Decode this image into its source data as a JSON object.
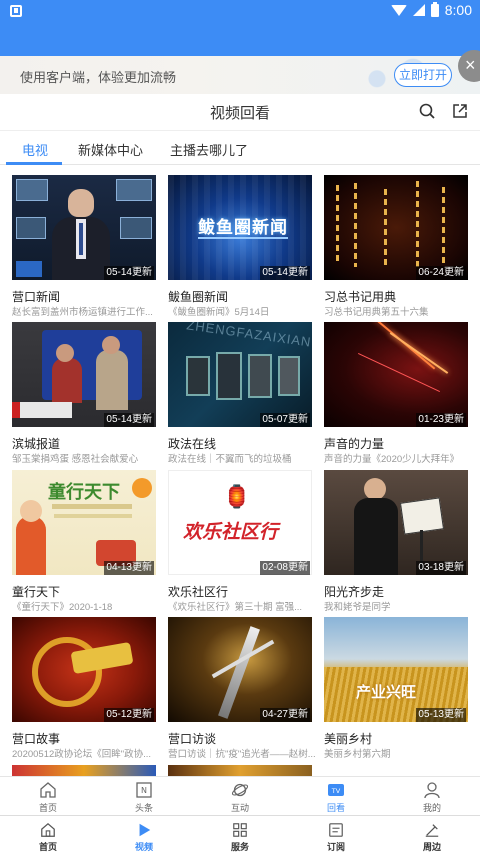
{
  "statusbar": {
    "time": "8:00"
  },
  "banner": {
    "text": "使用客户端，体验更加流畅",
    "button": "立即打开",
    "close": "×"
  },
  "header": {
    "title": "视频回看"
  },
  "tabs": [
    {
      "label": "电视"
    },
    {
      "label": "新媒体中心"
    },
    {
      "label": "主播去哪儿了"
    }
  ],
  "cards": [
    {
      "title": "营口新闻",
      "desc": "赵长富到盖州市杨运镇进行工作...",
      "date": "05-14更新"
    },
    {
      "title": "鲅鱼圈新闻",
      "desc": "《鲅鱼圈新闻》5月14日",
      "date": "05-14更新",
      "thumb_text": "鲅鱼圈新闻"
    },
    {
      "title": "习总书记用典",
      "desc": "习总书记用典第五十六集",
      "date": "06-24更新"
    },
    {
      "title": "滨城报道",
      "desc": "邹玉棠捐鸡蛋  感恩社会献爱心",
      "date": "05-14更新"
    },
    {
      "title": "政法在线",
      "desc": "政法在线｜不翼而飞的垃圾桶",
      "date": "05-07更新",
      "thumb_text": "ZHENGFAZAIXIAN"
    },
    {
      "title": "声音的力量",
      "desc": "声音的力量《2020少儿大拜年》",
      "date": "01-23更新"
    },
    {
      "title": "童行天下",
      "desc": "《童行天下》2020-1-18",
      "date": "04-13更新",
      "thumb_text": "童行天下"
    },
    {
      "title": "欢乐社区行",
      "desc": "《欢乐社区行》第三十期  富强...",
      "date": "02-08更新",
      "thumb_text": "欢乐社区行"
    },
    {
      "title": "阳光齐步走",
      "desc": "我和姥爷是同学",
      "date": "03-18更新"
    },
    {
      "title": "营口故事",
      "desc": "20200512政协论坛《回眸\"政协...",
      "date": "05-12更新"
    },
    {
      "title": "营口访谈",
      "desc": "营口访谈｜抗\"疫\"追光者——赵树...",
      "date": "04-27更新"
    },
    {
      "title": "美丽乡村",
      "desc": "美丽乡村第六期",
      "date": "05-13更新",
      "thumb_text": "产业兴旺"
    }
  ],
  "nav_top": [
    {
      "label": "首页",
      "icon": "home-icon"
    },
    {
      "label": "头条",
      "icon": "news-icon"
    },
    {
      "label": "互动",
      "icon": "planet-icon"
    },
    {
      "label": "回看",
      "icon": "tv-icon",
      "active": true
    },
    {
      "label": "我的",
      "icon": "person-icon"
    }
  ],
  "nav_bottom": [
    {
      "label": "首页",
      "icon": "home-icon"
    },
    {
      "label": "视频",
      "icon": "play-icon",
      "active": true
    },
    {
      "label": "服务",
      "icon": "grid-icon"
    },
    {
      "label": "订阅",
      "icon": "subscribe-icon"
    },
    {
      "label": "周边",
      "icon": "nearby-icon"
    }
  ],
  "colors": {
    "accent": "#3d8cf5",
    "statusbar": "#3d8cf5"
  }
}
